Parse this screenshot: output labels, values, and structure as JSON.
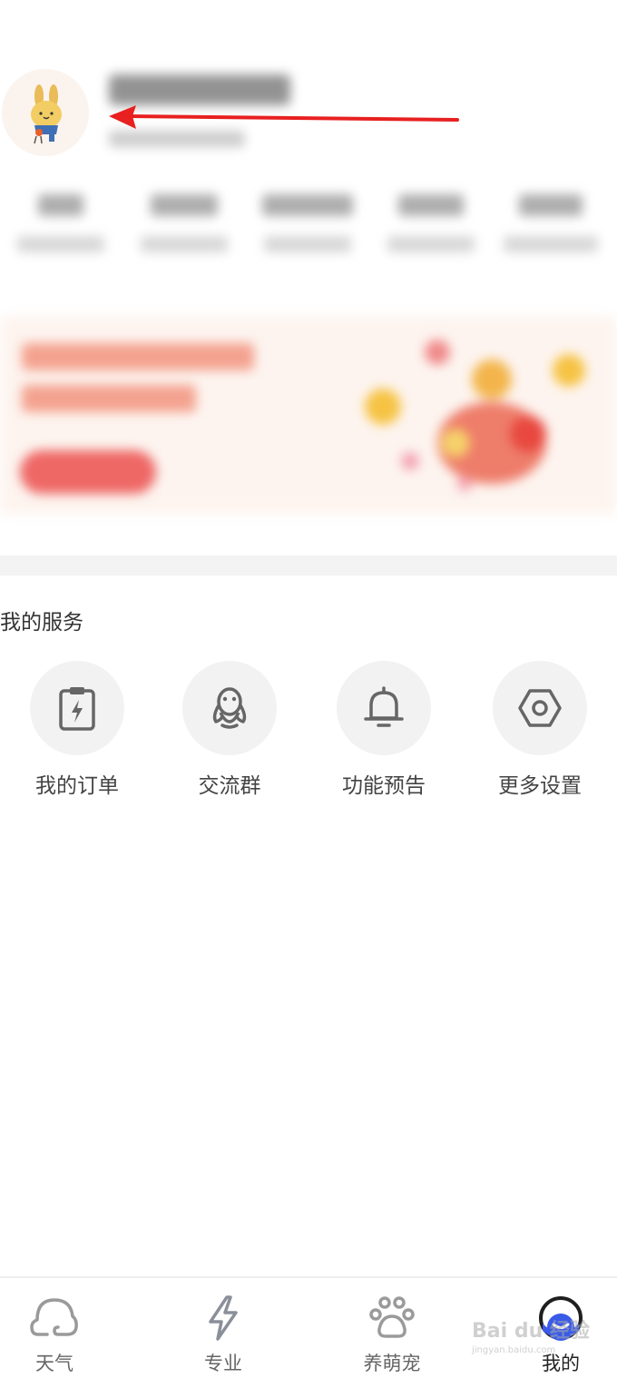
{
  "profile": {
    "avatar_icon": "bunny-avatar-icon",
    "name": "",
    "subtitle": ""
  },
  "stats": {
    "items": [
      {
        "value": "",
        "label": ""
      },
      {
        "value": "",
        "label": ""
      },
      {
        "value": "",
        "label": ""
      },
      {
        "value": "",
        "label": ""
      },
      {
        "value": "",
        "label": ""
      }
    ]
  },
  "banner": {
    "title": "",
    "subtitle": "",
    "button_label": ""
  },
  "services": {
    "title": "我的服务",
    "items": [
      {
        "label": "我的订单",
        "icon": "clipboard-icon"
      },
      {
        "label": "交流群",
        "icon": "qq-penguin-icon"
      },
      {
        "label": "功能预告",
        "icon": "bell-icon"
      },
      {
        "label": "更多设置",
        "icon": "settings-hexagon-icon"
      }
    ]
  },
  "tabbar": {
    "items": [
      {
        "label": "天气",
        "icon": "weather-icon"
      },
      {
        "label": "专业",
        "icon": "lightning-icon"
      },
      {
        "label": "养萌宠",
        "icon": "paw-icon"
      },
      {
        "label": "我的",
        "icon": "profile-icon",
        "active": true
      }
    ]
  },
  "watermark": {
    "text": "Bai du 经验",
    "url": "jingyan.baidu.com"
  },
  "colors": {
    "annotation_arrow": "#e82020",
    "active_tab": "#3a5be8",
    "banner_button": "#e83a38"
  }
}
